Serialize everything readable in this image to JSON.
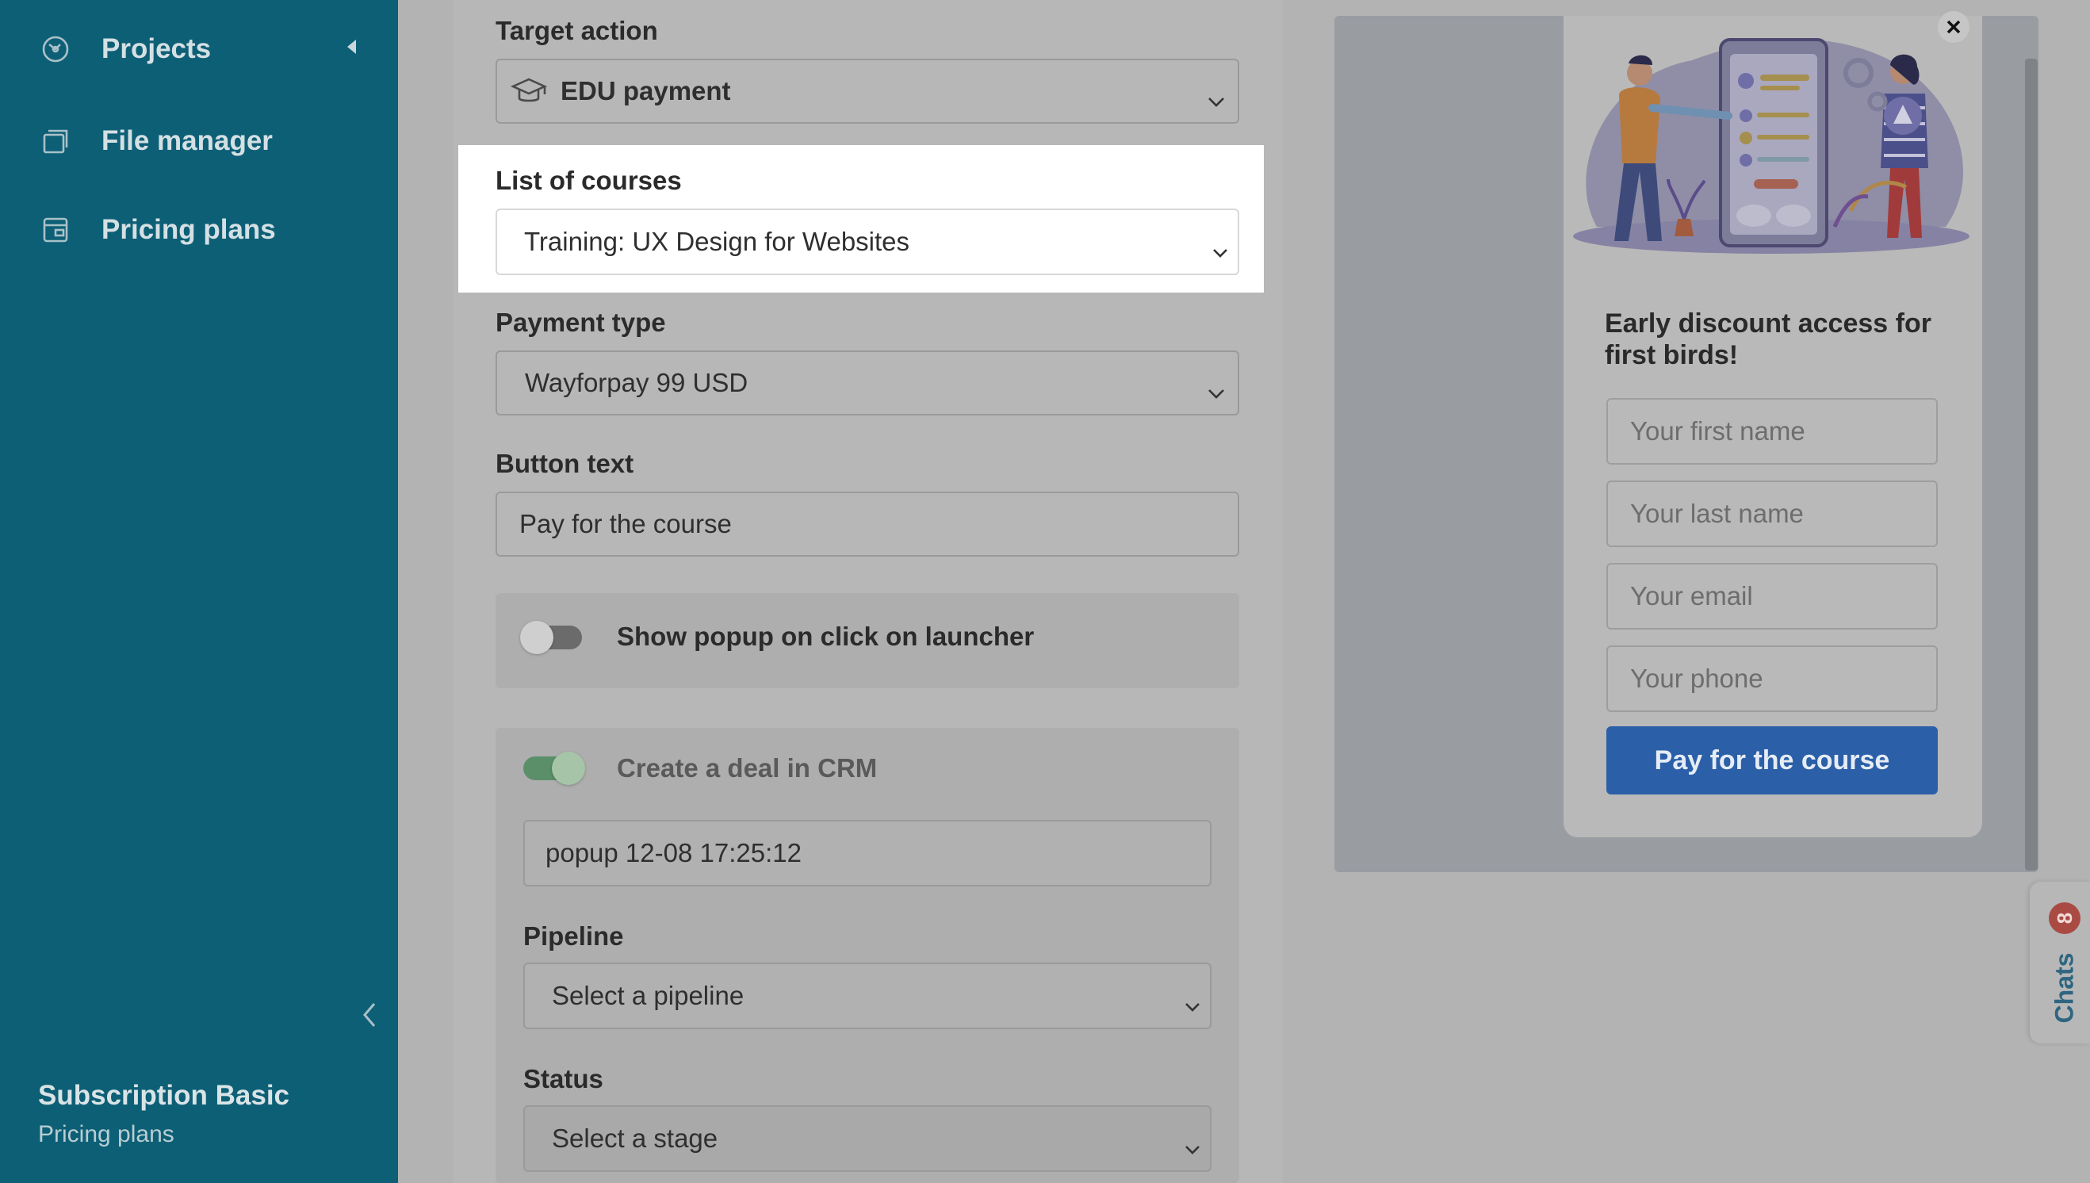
{
  "sidebar": {
    "items": [
      {
        "label": "Projects",
        "icon": "projects-icon"
      },
      {
        "label": "File manager",
        "icon": "file-manager-icon"
      },
      {
        "label": "Pricing plans",
        "icon": "pricing-plans-icon"
      }
    ],
    "plan_title": "Subscription Basic",
    "plan_subtitle": "Pricing plans"
  },
  "settings": {
    "target_action": {
      "label": "Target action",
      "value": "EDU payment",
      "icon": "graduation-cap-icon"
    },
    "list_of_courses": {
      "label": "List of courses",
      "value": "Training: UX Design for Websites"
    },
    "payment_type": {
      "label": "Payment type",
      "value": "Wayforpay 99 USD"
    },
    "button_text": {
      "label": "Button text",
      "value": "Pay for the course"
    },
    "show_popup_toggle": {
      "label": "Show popup on click on launcher",
      "on": false
    },
    "crm": {
      "toggle_label": "Create a deal in CRM",
      "on": true,
      "deal_name": "popup 12-08 17:25:12",
      "pipeline": {
        "label": "Pipeline",
        "placeholder": "Select a pipeline"
      },
      "status": {
        "label": "Status",
        "placeholder": "Select a stage"
      }
    }
  },
  "preview": {
    "title": "Early discount access for first birds!",
    "inputs": [
      "Your first name",
      "Your last name",
      "Your email",
      "Your phone"
    ],
    "button": "Pay for the course"
  },
  "chats": {
    "label": "Chats",
    "count": "8"
  },
  "colors": {
    "sidebar": "#0d5f76",
    "accent_button": "#2b5fa8",
    "toggle_on": "#5a8f6a",
    "badge": "#a94b43"
  }
}
